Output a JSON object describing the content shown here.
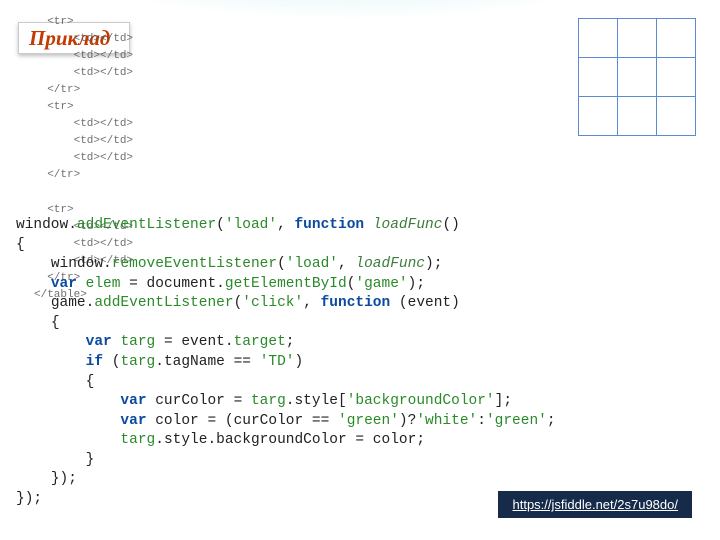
{
  "title": "Приклад",
  "faint_html": "  <tr>\n      <td></td>\n      <td></td>\n      <td></td>\n  </tr>\n  <tr>\n      <td></td>\n      <td></td>\n      <td></td>\n  </tr>\n\n  <tr>\n      <td></td>\n      <td></td>\n      <td></td>\n  </tr>\n</table>",
  "code_tokens": {
    "window": "window",
    "dot": ".",
    "addEventListener": "addEventListener",
    "removeEventListener": "removeEventListener",
    "getElementById": "getElementById",
    "function": "function",
    "var": "var",
    "if": "if",
    "loadFunc": "loadFunc",
    "elem": "elem",
    "document": "document",
    "game": "game",
    "event": "event",
    "targ": "targ",
    "curColor": "curColor",
    "color": "color",
    "tagName": "tagName",
    "style": "style",
    "backgroundColor_prop": "backgroundColor",
    "target_prop": "target",
    "str_load": "'load'",
    "str_game": "'game'",
    "str_click": "'click'",
    "str_TD": "'TD'",
    "str_bgColor": "'backgroundColor'",
    "str_green": "'green'",
    "str_white": "'white'",
    "lbrace": "{",
    "rbrace": "}",
    "lparen": "(",
    "rparen": ")",
    "semi": ";",
    "comma": ",",
    "eq": "=",
    "eqeq": "==",
    "qmark": "?",
    "colon": ":",
    "lbrack": "[",
    "rbrack": "]",
    "rparen_close": "});",
    "empty_parens": "()"
  },
  "link": {
    "label": "https://jsfiddle.net/2s7u98do/"
  }
}
